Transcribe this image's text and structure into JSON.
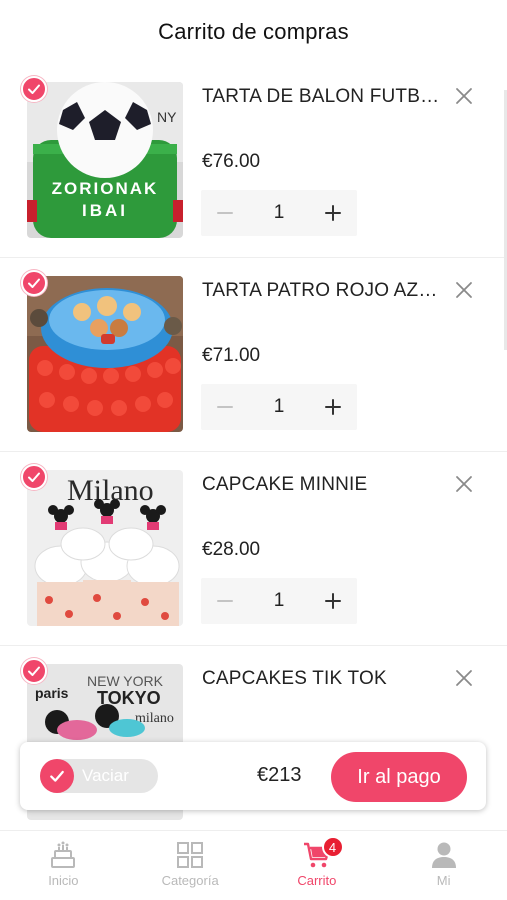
{
  "header": {
    "title": "Carrito de compras"
  },
  "items": [
    {
      "title": "TARTA DE BALON FUTBO···",
      "price": "€76.00",
      "qty": "1",
      "image": "soccer-ball-cake-image"
    },
    {
      "title": "TARTA PATRO ROJO AZU···",
      "price": "€71.00",
      "qty": "1",
      "image": "paw-patrol-cake-image"
    },
    {
      "title": "CAPCAKE MINNIE",
      "price": "€28.00",
      "qty": "1",
      "image": "minnie-cupcakes-image"
    },
    {
      "title": "CAPCAKES TIK TOK",
      "price": "",
      "qty": "",
      "image": "tiktok-cupcakes-image"
    }
  ],
  "checkout": {
    "select_all_label": "Vaciar",
    "total": "€213",
    "pay_label": "Ir al pago"
  },
  "tabbar": {
    "tabs": [
      {
        "label": "Inicio",
        "icon": "cake-icon",
        "active": false
      },
      {
        "label": "Categoría",
        "icon": "grid-icon",
        "active": false
      },
      {
        "label": "Carrito",
        "icon": "cart-icon",
        "active": true,
        "badge": "4"
      },
      {
        "label": "Mi",
        "icon": "user-icon",
        "active": false
      }
    ]
  },
  "colors": {
    "accent": "#f0466a",
    "badge": "#e81f32",
    "muted": "#b9b9b9"
  }
}
